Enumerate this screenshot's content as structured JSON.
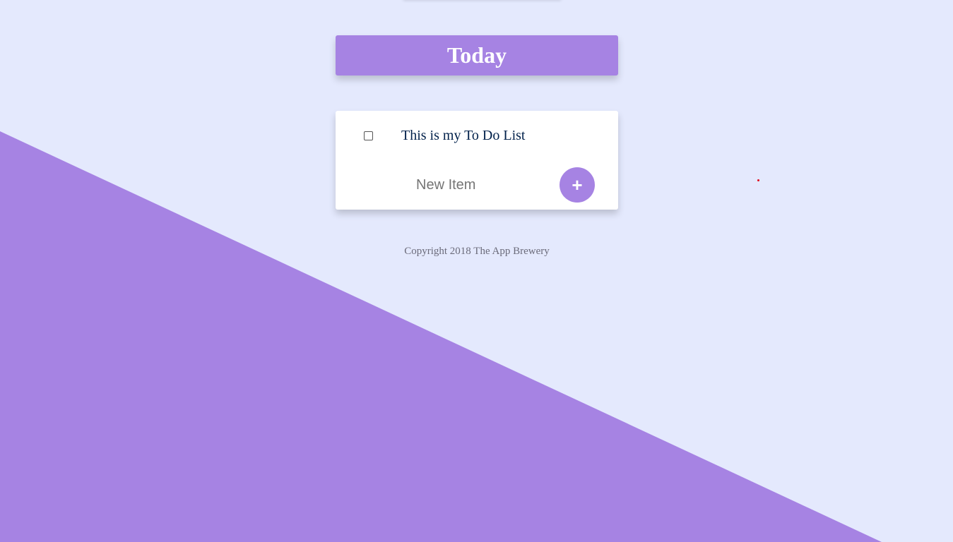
{
  "colors": {
    "page_background": "#E4E9FD",
    "accent": "#A683E3",
    "card_background": "#FFFFFF",
    "item_text": "#00204A",
    "footer_text": "#6B6B7A",
    "cursor_dot": "#E0001A"
  },
  "heading": {
    "title": "Today"
  },
  "todo_list": {
    "items": [
      {
        "label": "This is my To Do List",
        "checked": false
      }
    ],
    "new_item": {
      "placeholder": "New Item",
      "value": "",
      "add_button_label": "+",
      "add_button_icon": "plus-icon"
    }
  },
  "footer": {
    "copyright": "Copyright 2018 The App Brewery"
  }
}
